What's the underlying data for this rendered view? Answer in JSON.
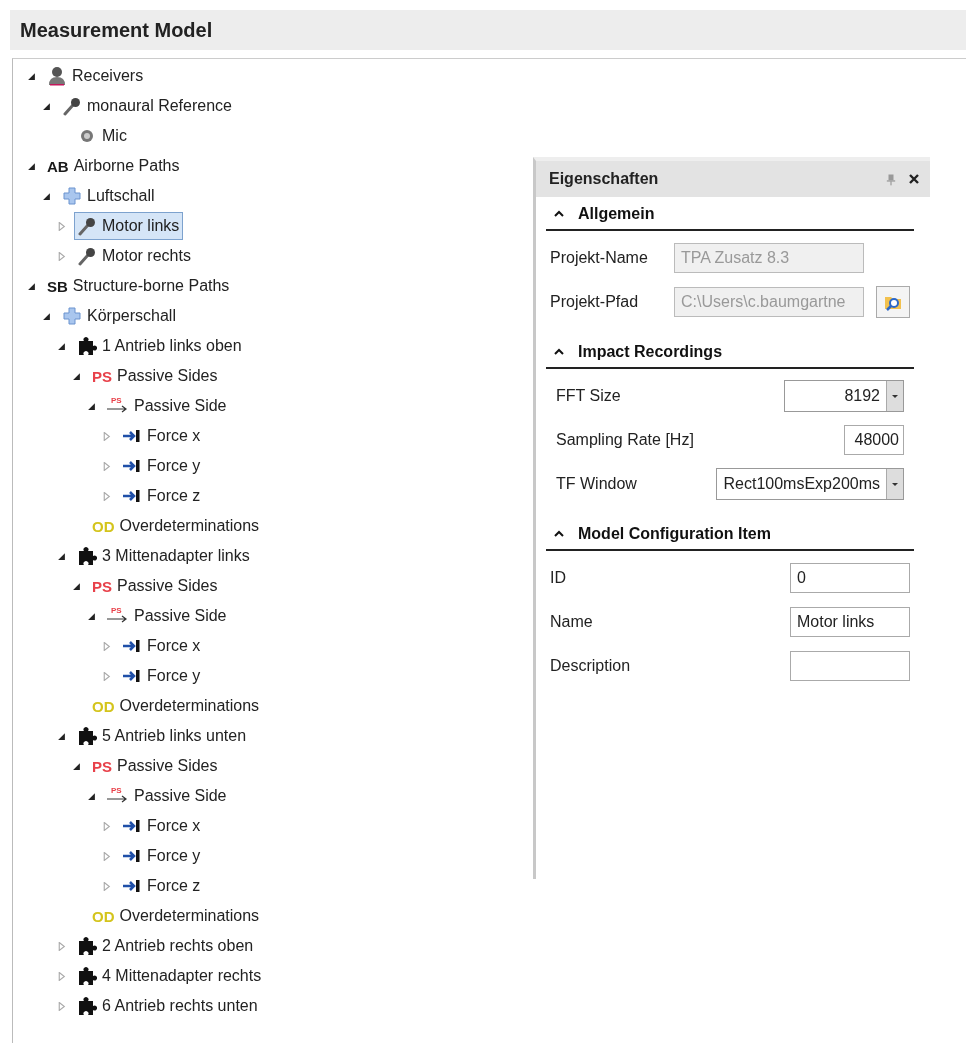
{
  "header": {
    "title": "Measurement Model"
  },
  "tree": [
    {
      "label": "Receivers",
      "kind": "person",
      "expanded": true,
      "selected": false,
      "children": [
        {
          "label": "monaural Reference",
          "kind": "mic",
          "expanded": true,
          "selected": false,
          "children": [
            {
              "label": "Mic",
              "kind": "speaker",
              "selected": false
            }
          ]
        }
      ]
    },
    {
      "label": "Airborne Paths",
      "kind": "badge",
      "badge": "AB",
      "color": "#1a1a1a",
      "expanded": true,
      "selected": false,
      "children": [
        {
          "label": "Luftschall",
          "kind": "cross",
          "expanded": true,
          "selected": false,
          "children": [
            {
              "label": "Motor links",
              "kind": "mic",
              "expanded": false,
              "selected": true
            },
            {
              "label": "Motor rechts",
              "kind": "mic",
              "expanded": false,
              "selected": false
            }
          ]
        }
      ]
    },
    {
      "label": "Structure-borne Paths",
      "kind": "badge",
      "badge": "SB",
      "color": "#1a1a1a",
      "expanded": true,
      "selected": false,
      "children": [
        {
          "label": "Körperschall",
          "kind": "cross",
          "expanded": true,
          "selected": false,
          "children": [
            {
              "label": "1 Antrieb links oben",
              "kind": "puzzle",
              "expanded": true,
              "selected": false,
              "children": [
                {
                  "label": "Passive Sides",
                  "kind": "badge",
                  "badge": "PS",
                  "color": "#e8414a",
                  "expanded": true,
                  "selected": false,
                  "children": [
                    {
                      "label": "Passive Side",
                      "kind": "side",
                      "badge": "PS",
                      "color": "#e8414a",
                      "expanded": true,
                      "selected": false,
                      "children": [
                        {
                          "label": "Force x",
                          "kind": "force",
                          "expanded": false,
                          "selected": false
                        },
                        {
                          "label": "Force y",
                          "kind": "force",
                          "expanded": false,
                          "selected": false
                        },
                        {
                          "label": "Force z",
                          "kind": "force",
                          "expanded": false,
                          "selected": false
                        }
                      ]
                    }
                  ]
                },
                {
                  "label": "Overdeterminations",
                  "kind": "badge",
                  "badge": "OD",
                  "color": "#d4c41c",
                  "selected": false
                }
              ]
            },
            {
              "label": "3 Mittenadapter links",
              "kind": "puzzle",
              "expanded": true,
              "selected": false,
              "children": [
                {
                  "label": "Passive Sides",
                  "kind": "badge",
                  "badge": "PS",
                  "color": "#e8414a",
                  "expanded": true,
                  "selected": false,
                  "children": [
                    {
                      "label": "Passive Side",
                      "kind": "side",
                      "badge": "PS",
                      "color": "#e8414a",
                      "expanded": true,
                      "selected": false,
                      "children": [
                        {
                          "label": "Force x",
                          "kind": "force",
                          "expanded": false,
                          "selected": false
                        },
                        {
                          "label": "Force y",
                          "kind": "force",
                          "expanded": false,
                          "selected": false
                        }
                      ]
                    }
                  ]
                },
                {
                  "label": "Overdeterminations",
                  "kind": "badge",
                  "badge": "OD",
                  "color": "#d4c41c",
                  "selected": false
                }
              ]
            },
            {
              "label": "5 Antrieb links unten",
              "kind": "puzzle",
              "expanded": true,
              "selected": false,
              "children": [
                {
                  "label": "Passive Sides",
                  "kind": "badge",
                  "badge": "PS",
                  "color": "#e8414a",
                  "expanded": true,
                  "selected": false,
                  "children": [
                    {
                      "label": "Passive Side",
                      "kind": "side",
                      "badge": "PS",
                      "color": "#e8414a",
                      "expanded": true,
                      "selected": false,
                      "children": [
                        {
                          "label": "Force x",
                          "kind": "force",
                          "expanded": false,
                          "selected": false
                        },
                        {
                          "label": "Force y",
                          "kind": "force",
                          "expanded": false,
                          "selected": false
                        },
                        {
                          "label": "Force z",
                          "kind": "force",
                          "expanded": false,
                          "selected": false
                        }
                      ]
                    }
                  ]
                },
                {
                  "label": "Overdeterminations",
                  "kind": "badge",
                  "badge": "OD",
                  "color": "#d4c41c",
                  "selected": false
                }
              ]
            },
            {
              "label": "2 Antrieb rechts oben",
              "kind": "puzzle",
              "expanded": false,
              "selected": false
            },
            {
              "label": "4 Mittenadapter rechts",
              "kind": "puzzle",
              "expanded": false,
              "selected": false
            },
            {
              "label": "6 Antrieb rechts unten",
              "kind": "puzzle",
              "expanded": false,
              "selected": false
            }
          ]
        }
      ]
    }
  ],
  "properties": {
    "title": "Eigenschaften",
    "sections": [
      {
        "title": "Allgemein",
        "expanded": true,
        "fields": [
          {
            "label": "Projekt-Name",
            "kind": "readonly",
            "value": "TPA Zusatz 8.3",
            "disabled": true
          },
          {
            "label": "Projekt-Pfad",
            "kind": "path",
            "value": "C:\\Users\\c.baumgartne",
            "disabled": true
          }
        ]
      },
      {
        "title": "Impact Recordings",
        "expanded": true,
        "fields": [
          {
            "label": "FFT Size",
            "kind": "combo",
            "value": "8192"
          },
          {
            "label": "Sampling Rate [Hz]",
            "kind": "number",
            "value": "48000"
          },
          {
            "label": "TF Window",
            "kind": "combo",
            "value": "Rect100msExp200ms"
          }
        ]
      },
      {
        "title": "Model Configuration Item",
        "expanded": true,
        "fields": [
          {
            "label": "ID",
            "kind": "text",
            "value": "0"
          },
          {
            "label": "Name",
            "kind": "text",
            "value": "Motor links"
          },
          {
            "label": "Description",
            "kind": "text"
          }
        ]
      }
    ]
  }
}
